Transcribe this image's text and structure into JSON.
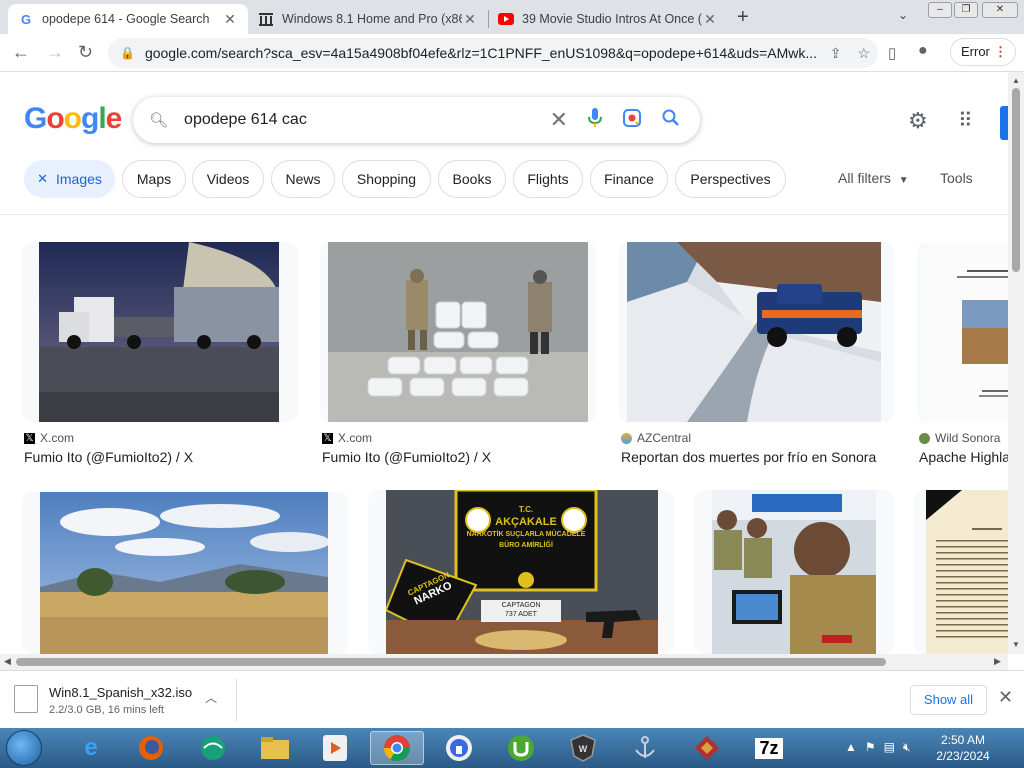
{
  "browser": {
    "tabs": [
      {
        "title": "opodepe 614 - Google Search",
        "icon": "G",
        "active": true
      },
      {
        "title": "Windows 8.1 Home and Pro (x86",
        "icon": "archive-icon",
        "active": false
      },
      {
        "title": "39 Movie Studio Intros At Once (",
        "icon": "youtube-icon",
        "active": false
      }
    ],
    "new_tab": "+",
    "url": "google.com/search?sca_esv=4a15a4908bf04efe&rlz=1C1PNFF_enUS1098&q=opodepe+614&uds=AMwk...",
    "error_label": "Error"
  },
  "google": {
    "logo": [
      "G",
      "o",
      "o",
      "g",
      "l",
      "e"
    ],
    "logo_colors": [
      "#4285f4",
      "#ea4335",
      "#fbbc05",
      "#4285f4",
      "#34a853",
      "#ea4335"
    ],
    "query": "opodepe 614 cac",
    "chips": [
      "Images",
      "Maps",
      "Videos",
      "News",
      "Shopping",
      "Books",
      "Flights",
      "Finance",
      "Perspectives"
    ],
    "chip_close": "✕",
    "all_filters": "All filters",
    "tools": "Tools"
  },
  "results": [
    {
      "source": "X.com",
      "title": "Fumio Ito (@FumioIto2) / X"
    },
    {
      "source": "X.com",
      "title": "Fumio Ito (@FumioIto2) / X"
    },
    {
      "source": "AZCentral",
      "title": "Reportan dos muertes por frío en Sonora"
    },
    {
      "source": "Wild Sonora",
      "title": "Apache Highla"
    }
  ],
  "row2_images": {
    "poster_lines": [
      "T.C.",
      "AKÇAKALE",
      "NARKOTİK SUÇLARLA MÜCADELE",
      "BÜRO AMİRLİĞİ"
    ],
    "captagon_label": "CAPTAGON",
    "captagon_count": "737 ADET",
    "captagon_stripe": "CAPTAGON",
    "narko_label": "NARKO"
  },
  "download": {
    "filename": "Win8.1_Spanish_x32.iso",
    "status": "2.2/3.0 GB, 16 mins left",
    "show_all": "Show all"
  },
  "taskbar": {
    "time": "2:50 AM",
    "date": "2/23/2024",
    "app_7z": "7z"
  }
}
